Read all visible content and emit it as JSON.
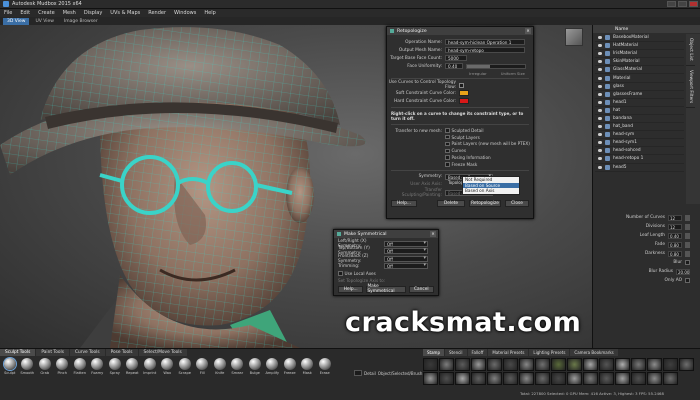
{
  "window": {
    "title": "Autodesk Mudbox 2015 x64"
  },
  "menu": [
    "File",
    "Edit",
    "Create",
    "Mesh",
    "Display",
    "UVs & Maps",
    "Render",
    "Windows",
    "Help"
  ],
  "view_tabs": [
    {
      "label": "3D View",
      "active": true
    },
    {
      "label": "UV View",
      "active": false
    },
    {
      "label": "Image Browser",
      "active": false
    }
  ],
  "retopo": {
    "title": "Retopologize",
    "operation_name_label": "Operation Name:",
    "operation_name_value": "head-sym-hiclean Operation 1",
    "output_mesh_label": "Output Mesh Name:",
    "output_mesh_value": "head-sym-retopo",
    "face_count_label": "Target Base Face Count:",
    "face_count_value": "5000",
    "uniformity_label": "Face Uniformity:",
    "uniformity_value": "0.40",
    "uniformity_fraction": 0.4,
    "range_left": "Irrregular",
    "range_right": "Uniform Size",
    "curves_label": "Use Curves to Control Topology Flow:",
    "soft_label": "Soft Constraint Curve Color:",
    "soft_color": "#e9a21a",
    "hard_label": "Hard Constraint Curve Color:",
    "hard_color": "#d81818",
    "hint": "Right-click on a curve to change its constraint type, or to turn it off.",
    "transfer_label": "Transfer to new mesh:",
    "transfer_items": [
      "Sculpted Detail",
      "Sculpt Layers",
      "Paint Layers (new mesh will be PTEX)",
      "Curves",
      "Posing Information",
      "Freeze Mask"
    ],
    "symmetry_label": "Symmetry:",
    "symmetry_value": "Based on Source Topology",
    "symmetry_options": [
      "Not Required",
      "Based on Source Topology",
      "Based on Axis"
    ],
    "symmetry_selected_index": 1,
    "user_axis_label": "User Axis Axis:",
    "transfer_pos_label": "Transfer Sculpting/Painting:",
    "transfer_pos_value": "Based on Mesh",
    "buttons": {
      "help": "Help...",
      "delete": "Delete",
      "retopologize": "Retopologize",
      "close": "Close"
    }
  },
  "symmetry_dialog": {
    "title": "Make Symmetrical",
    "rows": [
      {
        "label": "Left/Right (X) Symmetry:",
        "value": "Off"
      },
      {
        "label": "Top/Bottom (Y) Symmetry:",
        "value": "Off"
      },
      {
        "label": "Front/Back (Z) Symmetry:",
        "value": "Off"
      },
      {
        "label": "Trimming:",
        "value": "Off"
      }
    ],
    "use_local_axes": "Use Local Axes",
    "topology_axis_label": "Set Topologize Axis to:",
    "buttons": {
      "help": "Help...",
      "make": "Make Symmetrical",
      "cancel": "Cancel"
    }
  },
  "outliner": {
    "header": "Name",
    "items": [
      "BaseboxMaterial",
      "HatMaterial",
      "IrisMaterial",
      "SkinMaterial",
      "GlassMaterial",
      "Material",
      "glass",
      "glassesFrame",
      "head1",
      "hat",
      "bandana",
      "hat_band",
      "head-sym",
      "head-sym1",
      "head-sohced",
      "head-retopo 1",
      "head5"
    ],
    "side_tabs": [
      "Object List",
      "Viewport Filters"
    ]
  },
  "curve_props": [
    {
      "label": "Number of Curves",
      "value": "12"
    },
    {
      "label": "Divisions",
      "value": "12"
    },
    {
      "label": "Leaf Length",
      "value": "0.40"
    },
    {
      "label": "Fade",
      "value": "0.80"
    },
    {
      "label": "Darkness",
      "value": "0.80"
    },
    {
      "label": "Blur",
      "value": ""
    },
    {
      "label": "Blur Radius",
      "value": "20.00"
    },
    {
      "label": "Only AO",
      "value": ""
    }
  ],
  "bottom_tabs": [
    {
      "label": "Sculpt Tools",
      "active": true
    },
    {
      "label": "Paint Tools",
      "active": false
    },
    {
      "label": "Curve Tools",
      "active": false
    },
    {
      "label": "Pose Tools",
      "active": false
    },
    {
      "label": "Select/Move Tools",
      "active": false
    }
  ],
  "brushes": [
    "Sculpt",
    "Smooth",
    "Grab",
    "Pinch",
    "Flatten",
    "Foamy",
    "Spray",
    "Repeat",
    "Imprint",
    "Wax",
    "Scrape",
    "Fill",
    "Knife",
    "Smear",
    "Bulge",
    "Amplify",
    "Freeze",
    "Mask",
    "Erase"
  ],
  "detail": {
    "label": "Detail",
    "extra": "Object/Selected/Brush"
  },
  "stamp_tabs": [
    {
      "label": "Stamp",
      "active": true
    },
    {
      "label": "Stencil",
      "active": false
    },
    {
      "label": "Falloff",
      "active": false
    },
    {
      "label": "Material Presets",
      "active": false
    },
    {
      "label": "Lighting Presets",
      "active": false
    },
    {
      "label": "Camera Bookmarks",
      "active": false
    }
  ],
  "stamp_colors": [
    "#3a3a3a",
    "#7d7d7d",
    "#5c5c5c",
    "#9a9a9a",
    "#6b6b6b",
    "#4a4a4a",
    "#888",
    "#707070",
    "#5a6a3a",
    "#6b7a4a",
    "#a8a8a8",
    "#555",
    "#b0b0b0",
    "#777",
    "#8d8d8d",
    "#3f3f3f",
    "#6e6e6e",
    "#999",
    "#4f4f4f",
    "#aaa",
    "#606060",
    "#808080",
    "#5b5b5b",
    "#8a8a8a",
    "#6a6a6a",
    "#474747",
    "#9d9d9d",
    "#7a7a7a",
    "#595959",
    "#a2a2a2",
    "#505050",
    "#8c8c8c",
    "#6d6d6d"
  ],
  "status": "Total: 227800  Selected: 0  GPU Mem: 416  Active: 3, Highest: 3  FPS: 55.2468",
  "watermark": "cracksmat.com",
  "colors": {
    "accent": "#3a6ea5",
    "wire": "#3ad3c8"
  }
}
